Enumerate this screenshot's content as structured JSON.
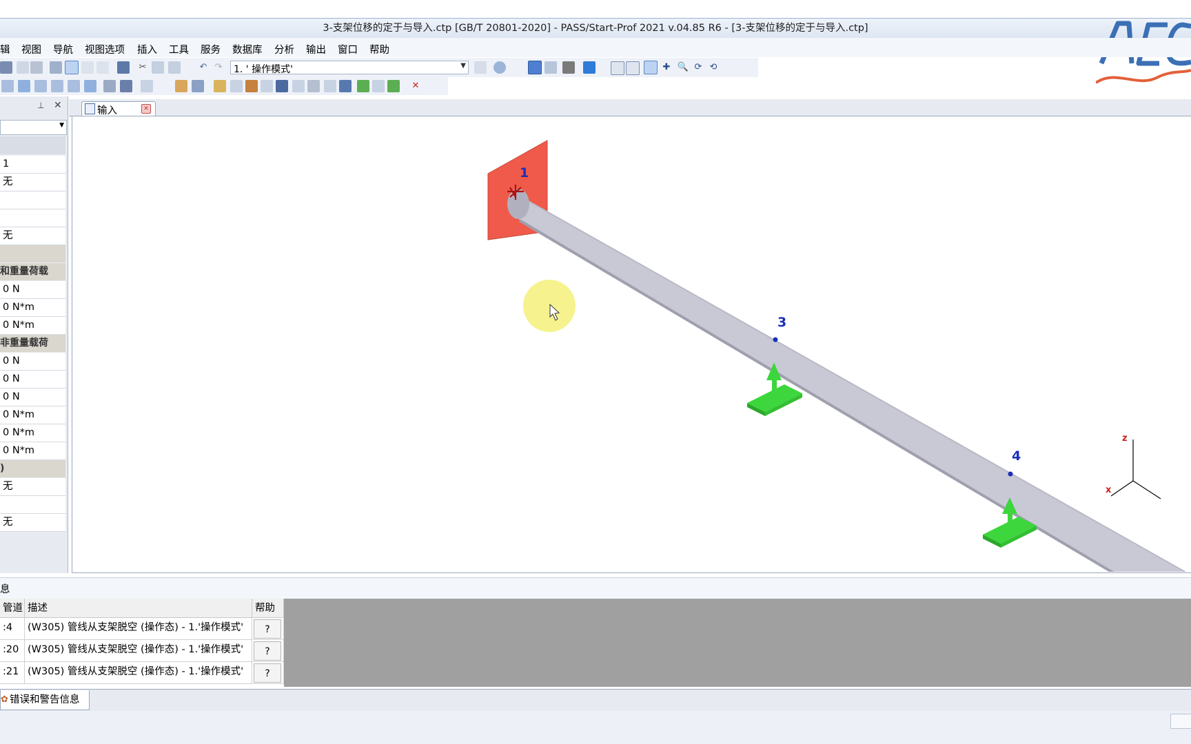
{
  "window": {
    "title": "3-支架位移的定于与导入.ctp [GB/T 20801-2020] - PASS/Start-Prof 2021 v.04.85 R6 - [3-支架位移的定于与导入.ctp]"
  },
  "menu": [
    "辑",
    "视图",
    "导航",
    "视图选项",
    "插入",
    "工具",
    "服务",
    "数据库",
    "分析",
    "输出",
    "窗口",
    "帮助"
  ],
  "toolbar": {
    "mode_select": "1. ' 操作模式'"
  },
  "left_panel": {
    "pin_icon": "pin-icon",
    "close_icon": "close-icon",
    "rows": [
      {
        "type": "value",
        "text": "1"
      },
      {
        "type": "value",
        "text": "无"
      },
      {
        "type": "value",
        "text": ""
      },
      {
        "type": "value",
        "text": ""
      },
      {
        "type": "value",
        "text": "无"
      },
      {
        "type": "group",
        "text": ""
      },
      {
        "type": "group",
        "text": "和重量荷载"
      },
      {
        "type": "value",
        "text": "0 N"
      },
      {
        "type": "value",
        "text": "0 N*m"
      },
      {
        "type": "value",
        "text": "0 N*m"
      },
      {
        "type": "group",
        "text": "非重量载荷"
      },
      {
        "type": "value",
        "text": "0 N"
      },
      {
        "type": "value",
        "text": "0 N"
      },
      {
        "type": "value",
        "text": "0 N"
      },
      {
        "type": "value",
        "text": "0 N*m"
      },
      {
        "type": "value",
        "text": "0 N*m"
      },
      {
        "type": "value",
        "text": "0 N*m"
      },
      {
        "type": "group",
        "text": ")"
      },
      {
        "type": "value",
        "text": "无"
      },
      {
        "type": "value",
        "text": ""
      },
      {
        "type": "value",
        "text": "无"
      }
    ]
  },
  "tabs": [
    {
      "label": "输入"
    }
  ],
  "viewport": {
    "nodes": [
      {
        "label": "1"
      },
      {
        "label": "3"
      },
      {
        "label": "4"
      }
    ],
    "axes": {
      "z": "z",
      "x": "x"
    },
    "colors": {
      "pipe": "#c9c9d6",
      "anchor": "#ef5a4a",
      "support": "#3dd63d",
      "node_label": "#1a2fb8"
    }
  },
  "messages": {
    "panel_title": "息",
    "columns": [
      "管道",
      "描述",
      "帮助"
    ],
    "rows": [
      {
        "pipe": ":4",
        "desc": "(W305) 管线从支架脱空 (操作态) - 1.'操作模式'",
        "help": "?"
      },
      {
        "pipe": ":20",
        "desc": "(W305) 管线从支架脱空 (操作态) - 1.'操作模式'",
        "help": "?"
      },
      {
        "pipe": ":21",
        "desc": "(W305) 管线从支架脱空 (操作态) - 1.'操作模式'",
        "help": "?"
      }
    ]
  },
  "bottom_tabs": [
    {
      "label": "错误和警告信息"
    }
  ]
}
